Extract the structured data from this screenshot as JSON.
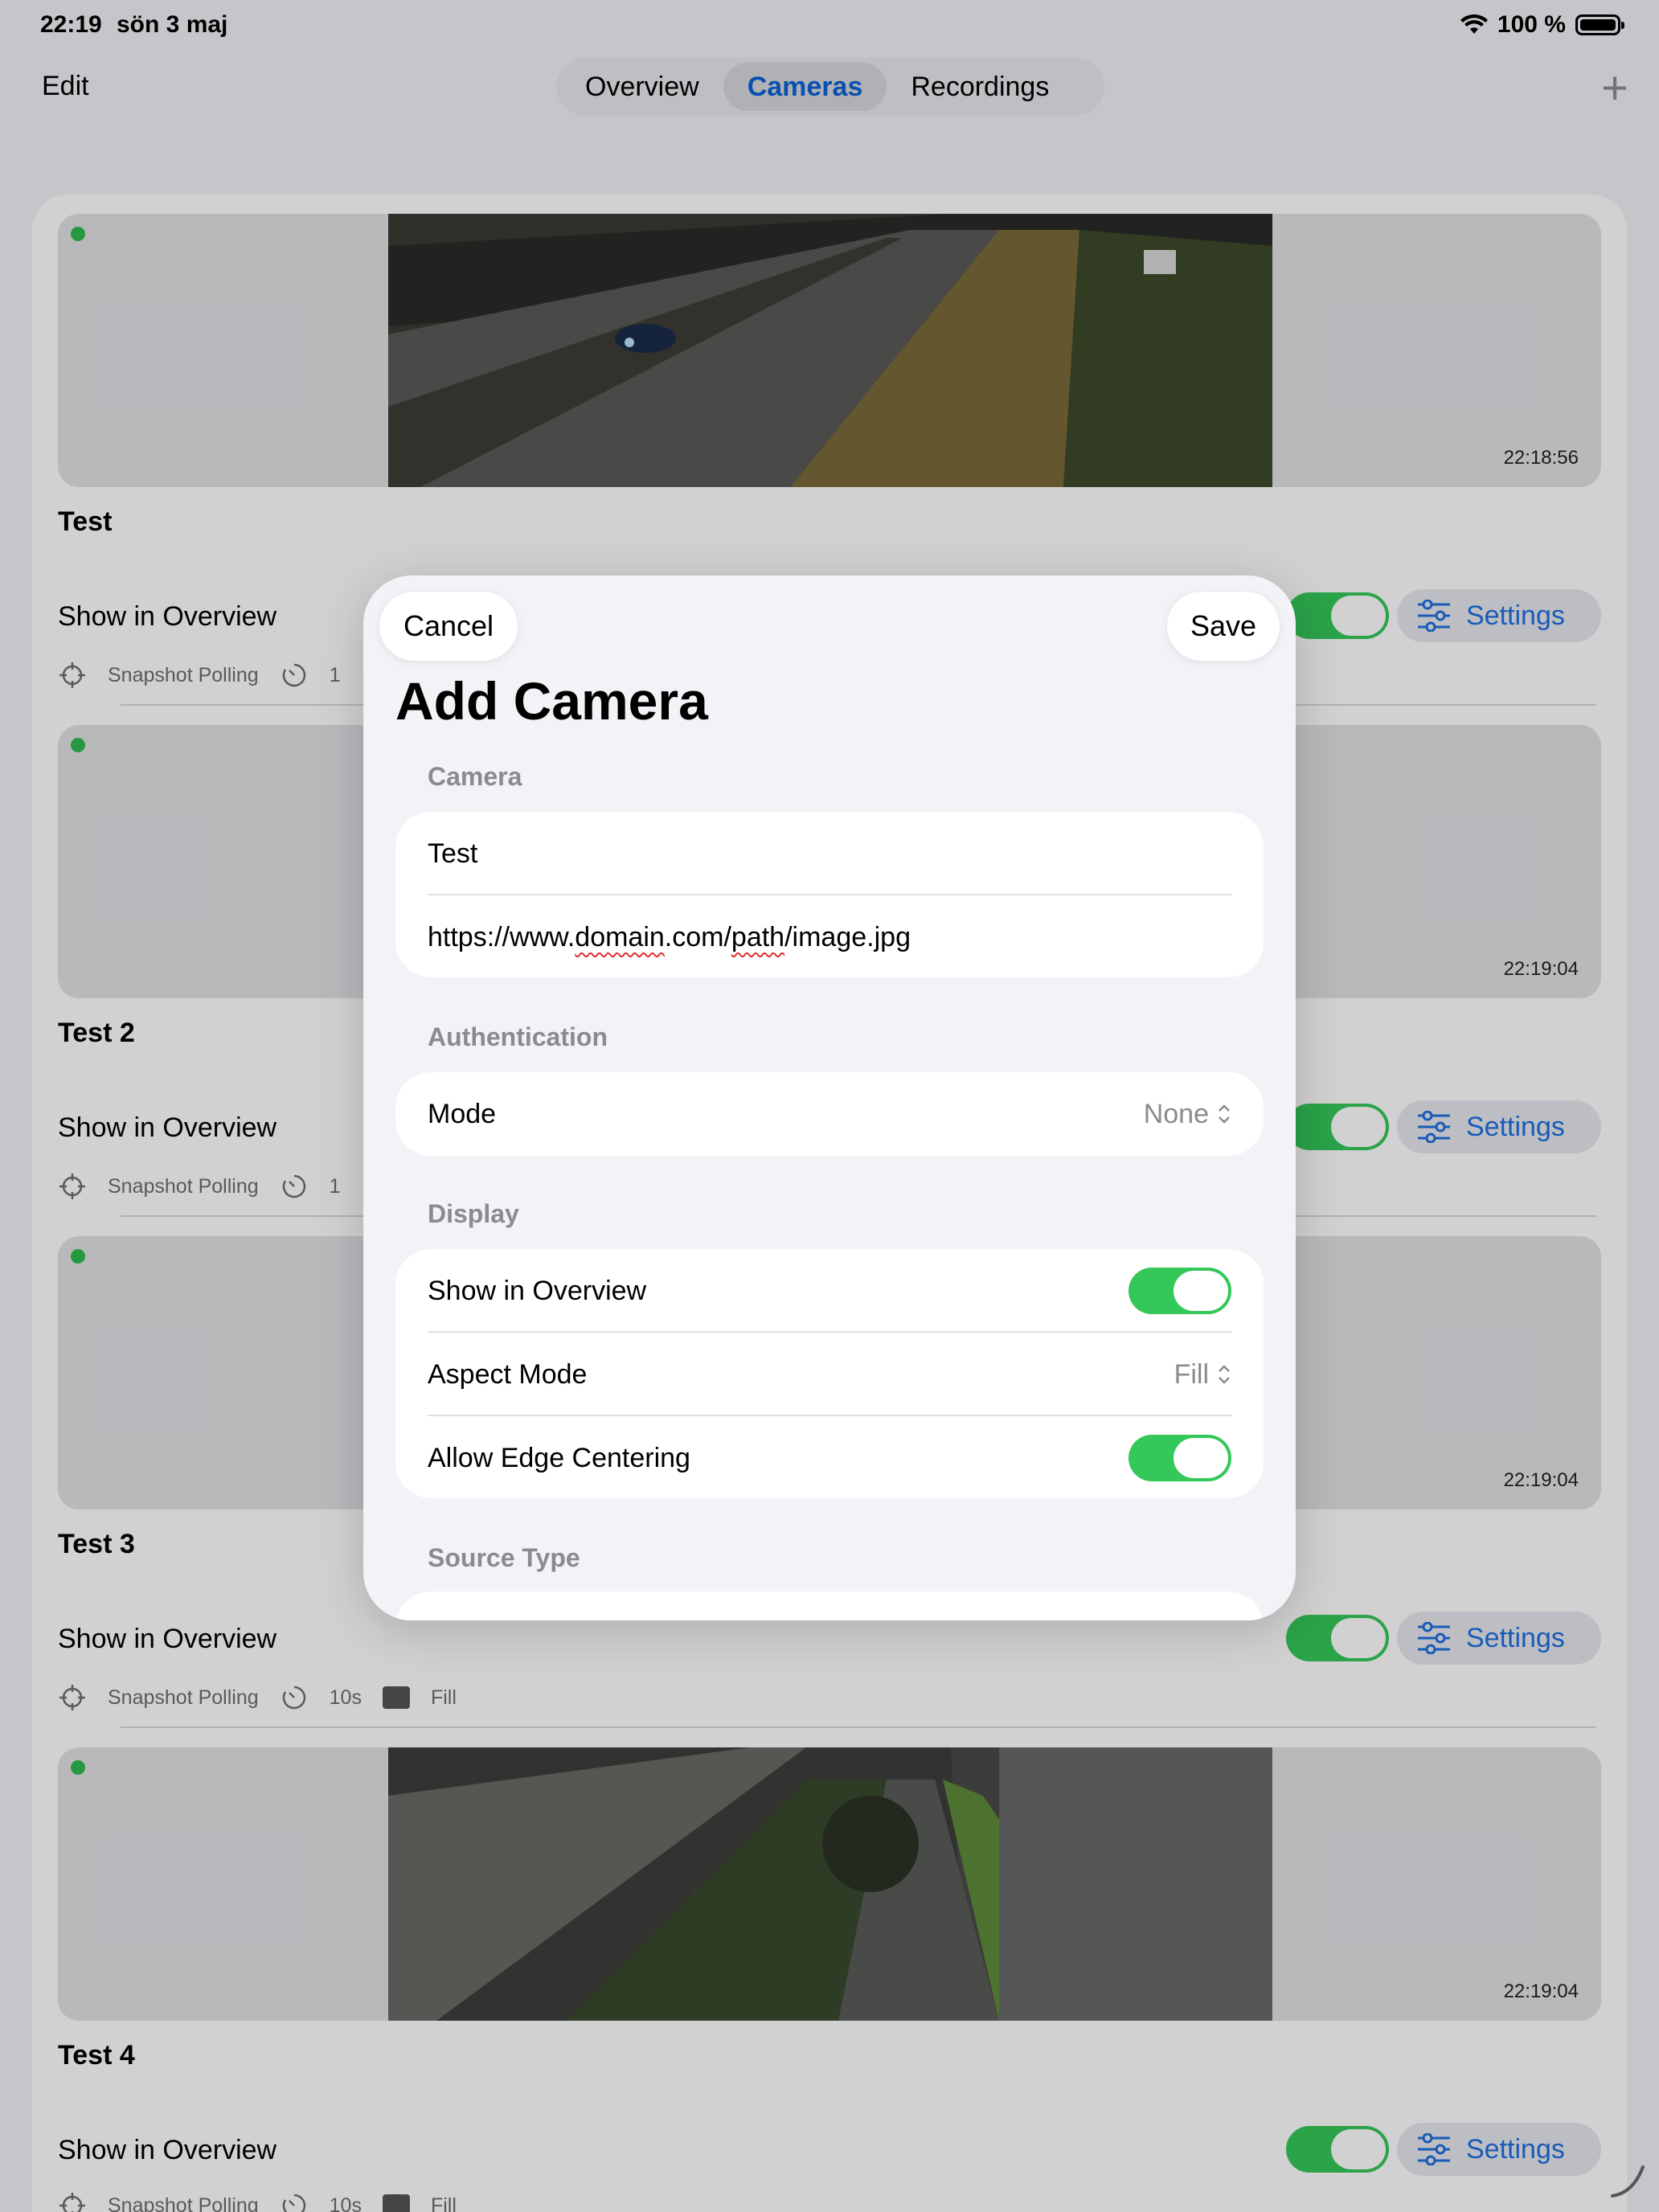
{
  "status_bar": {
    "time": "22:19",
    "date": "sön 3 maj",
    "battery": "100 %"
  },
  "nav": {
    "edit_label": "Edit",
    "tabs": [
      {
        "label": "Overview",
        "active": false
      },
      {
        "label": "Cameras",
        "active": true
      },
      {
        "label": "Recordings",
        "active": false
      }
    ],
    "add_icon": "plus-icon"
  },
  "cameras": [
    {
      "title": "Test",
      "timestamp": "22:18:56",
      "show_label": "Show in Overview",
      "show_in_overview": true,
      "settings_label": "Settings",
      "polling": "Snapshot Polling",
      "interval": "1",
      "aspect": ""
    },
    {
      "title": "Test 2",
      "timestamp": "22:19:04",
      "show_label": "Show in Overview",
      "show_in_overview": true,
      "settings_label": "Settings",
      "polling": "Snapshot Polling",
      "interval": "1",
      "aspect": ""
    },
    {
      "title": "Test 3",
      "timestamp": "22:19:04",
      "show_label": "Show in Overview",
      "show_in_overview": true,
      "settings_label": "Settings",
      "polling": "Snapshot Polling",
      "interval": "10s",
      "aspect": "Fill"
    },
    {
      "title": "Test 4",
      "timestamp": "22:19:04",
      "show_label": "Show in Overview",
      "show_in_overview": true,
      "settings_label": "Settings",
      "polling": "Snapshot Polling",
      "interval": "10s",
      "aspect": "Fill"
    }
  ],
  "modal": {
    "cancel_label": "Cancel",
    "save_label": "Save",
    "title": "Add Camera",
    "sections": {
      "camera": {
        "header": "Camera",
        "name_value": "Test",
        "url_pre": "https://www.",
        "url_err1": "domain",
        "url_mid": ".com/",
        "url_err2": "path",
        "url_post": "/image.jpg"
      },
      "authentication": {
        "header": "Authentication",
        "mode_label": "Mode",
        "mode_value": "None"
      },
      "display": {
        "header": "Display",
        "show_label": "Show in Overview",
        "show_on": true,
        "aspect_label": "Aspect Mode",
        "aspect_value": "Fill",
        "edge_label": "Allow Edge Centering",
        "edge_on": true
      },
      "source_type": {
        "header": "Source Type"
      }
    }
  },
  "colors": {
    "accent": "#1f6fe0",
    "toggle_on": "#34c759",
    "live_dot": "#2fba4f"
  }
}
